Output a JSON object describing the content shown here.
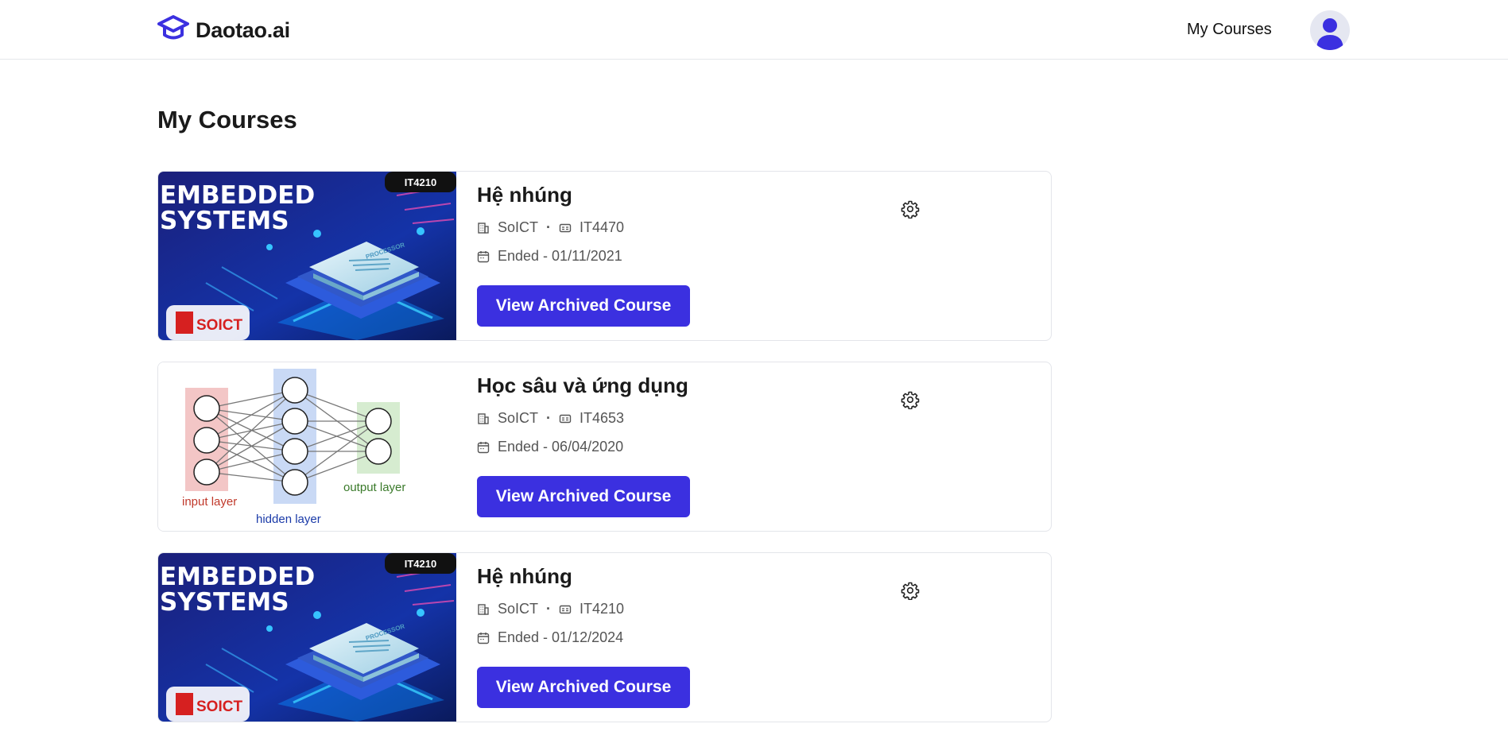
{
  "header": {
    "logo_text": "Daotao.ai",
    "nav_my_courses": "My Courses"
  },
  "page": {
    "title": "My Courses"
  },
  "colors": {
    "accent": "#3b30e0",
    "button_text": "#ffffff"
  },
  "courses": [
    {
      "title": "Hệ nhúng",
      "school": "SoICT",
      "code": "IT4470",
      "status": "Ended - 01/11/2021",
      "button": "View Archived Course",
      "thumbnail": {
        "kind": "embedded",
        "badge": "IT4210",
        "line1": "EMBEDDED",
        "line2": "SYSTEMS",
        "chip_text": "PROCESSOR",
        "logo": "SOICT"
      }
    },
    {
      "title": "Học sâu và ứng dụng",
      "school": "SoICT",
      "code": "IT4653",
      "status": "Ended - 06/04/2020",
      "button": "View Archived Course",
      "thumbnail": {
        "kind": "neural",
        "input_label": "input layer",
        "hidden_label": "hidden layer",
        "output_label": "output layer"
      }
    },
    {
      "title": "Hệ nhúng",
      "school": "SoICT",
      "code": "IT4210",
      "status": "Ended - 01/12/2024",
      "button": "View Archived Course",
      "thumbnail": {
        "kind": "embedded",
        "badge": "IT4210",
        "line1": "EMBEDDED",
        "line2": "SYSTEMS",
        "chip_text": "PROCESSOR",
        "logo": "SOICT"
      }
    }
  ]
}
